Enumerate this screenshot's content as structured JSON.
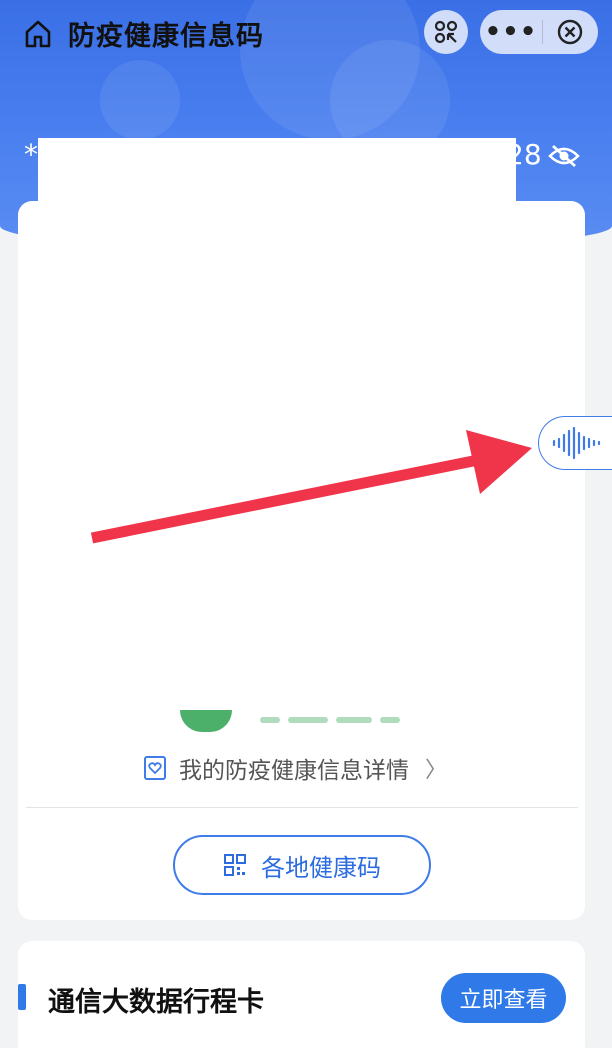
{
  "header": {
    "title": "防疫健康信息码",
    "masked_prefix": "*",
    "masked_suffix": "28",
    "icons": {
      "home": "home-icon",
      "scan": "scan-icon",
      "more": "more-dots-icon",
      "close": "close-circle-icon",
      "eye": "eye-hidden-icon"
    },
    "more_label": "•••"
  },
  "main_card": {
    "detail_link_label": "我的防疫健康信息详情",
    "detail_icon": "heart-shield-icon",
    "local_codes_button_label": "各地健康码",
    "local_codes_icon": "qr-code-icon",
    "status_color": "#4caf6a"
  },
  "trip_card": {
    "title": "通信大数据行程卡",
    "button_label": "立即查看"
  },
  "voice_assistant": {
    "icon": "sound-wave-icon"
  },
  "annotation": {
    "icon": "red-arrow-icon",
    "color": "#f0344a"
  },
  "colors": {
    "brand_blue": "#2f7ae8",
    "header_blue": "#3a6fe6"
  }
}
